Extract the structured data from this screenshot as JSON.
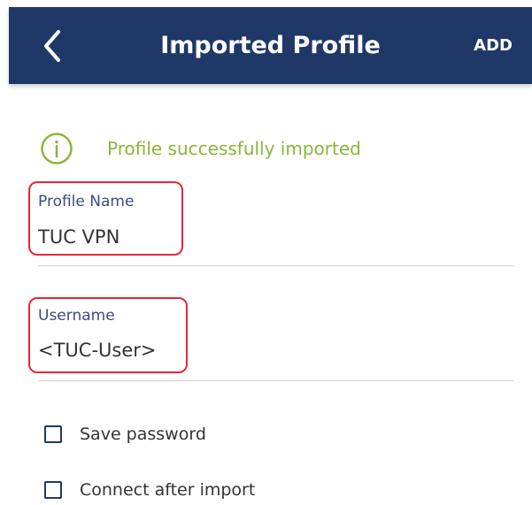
{
  "header": {
    "title": "Imported Profile",
    "back_icon": "chevron-left-icon",
    "add_label": "ADD"
  },
  "notice": {
    "icon": "info-icon",
    "text": "Profile successfully imported",
    "color": "#8cb53a"
  },
  "form": {
    "profile_name": {
      "label": "Profile Name",
      "value": "TUC VPN"
    },
    "username": {
      "label": "Username",
      "value": "<TUC-User>"
    },
    "options": [
      {
        "label": "Save password",
        "checked": false
      },
      {
        "label": "Connect after import",
        "checked": false
      }
    ]
  },
  "colors": {
    "app_bar": "#1f3868",
    "field_label": "#3a4d80",
    "highlight": "#e8273b"
  }
}
